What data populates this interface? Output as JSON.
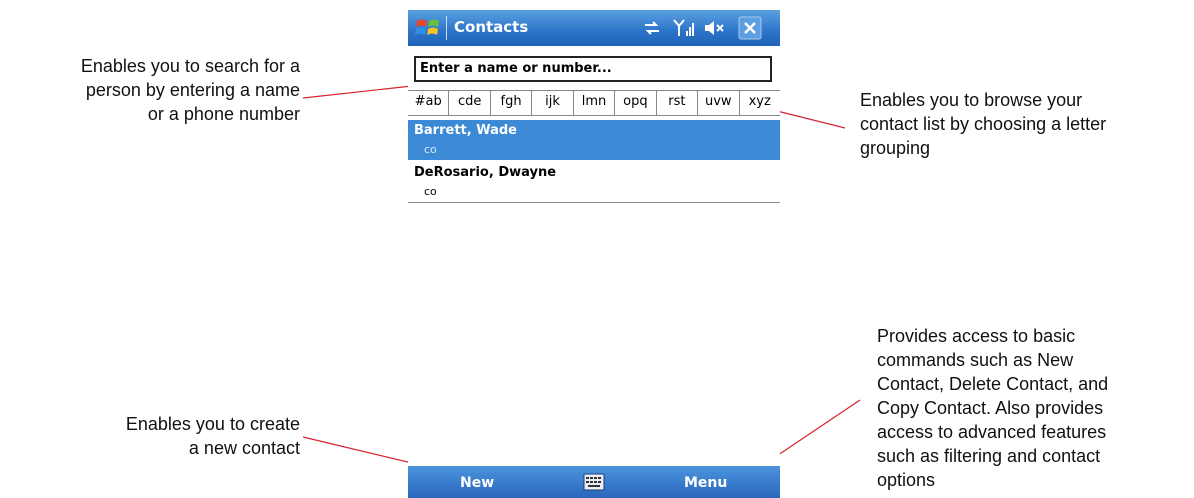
{
  "window": {
    "title": "Contacts",
    "icons": [
      "windows-flag-icon",
      "sync-icon",
      "signal-icon",
      "speaker-muted-icon",
      "close-icon"
    ]
  },
  "search": {
    "placeholder": "Enter a name or number..."
  },
  "letter_tabs": [
    "#ab",
    "cde",
    "fgh",
    "ijk",
    "lmn",
    "opq",
    "rst",
    "uvw",
    "xyz"
  ],
  "contacts": [
    {
      "name": "Barrett, Wade",
      "code": "co",
      "selected": true
    },
    {
      "name": "DeRosario, Dwayne",
      "code": "co",
      "selected": false
    }
  ],
  "softkeys": {
    "left": "New",
    "right": "Menu",
    "input_icon": "keyboard-icon"
  },
  "callouts": {
    "search": [
      "Enables you to search for a",
      "person by entering a name",
      "or a phone number"
    ],
    "browse": [
      "Enables you to browse your",
      "contact list by choosing a letter",
      "grouping"
    ],
    "new": [
      "Enables you to create",
      "a new contact"
    ],
    "menu": [
      "Provides access to basic",
      "commands such as New",
      "Contact, Delete Contact, and",
      "Copy Contact. Also provides",
      "access to advanced features",
      "such as filtering and contact",
      "options"
    ]
  },
  "colors": {
    "titlebar": "#2c74c9",
    "selection": "#3c8ad6",
    "callout_line": "#d9242f"
  }
}
